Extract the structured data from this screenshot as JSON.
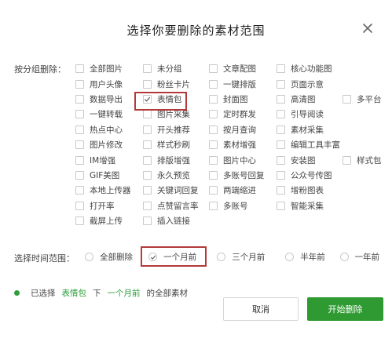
{
  "dialog": {
    "title": "选择你要删除的素材范围"
  },
  "group": {
    "label": "按分组删除：",
    "rows": [
      [
        "全部图片",
        "未分组",
        "文章配图",
        "核心功能图"
      ],
      [
        "用户头像",
        "粉丝卡片",
        "一键排版",
        "页面示意"
      ],
      [
        "数据导出",
        "表情包",
        "封面图",
        "高清图",
        "多平台"
      ],
      [
        "一键转载",
        "图片采集",
        "定时群发",
        "引导阅读"
      ],
      [
        "热点中心",
        "开头推荐",
        "按月查询",
        "素材采集"
      ],
      [
        "图片修改",
        "样式秒刷",
        "素材增强",
        "编辑工具丰富"
      ],
      [
        "IM增强",
        "排版增强",
        "图片中心",
        "安装图",
        "样式包"
      ],
      [
        "GIF美图",
        "永久预览",
        "多账号回复",
        "公众号传图"
      ],
      [
        "本地上传器",
        "关键词回复",
        "两端缩进",
        "增粉图表"
      ],
      [
        "打开率",
        "点赞留言率",
        "多账号",
        "智能采集"
      ],
      [
        "截屏上传",
        "插入链接"
      ]
    ],
    "checked": "表情包"
  },
  "time": {
    "label": "选择时间范围：",
    "options": [
      "全部删除",
      "一个月前",
      "三个月前",
      "半年前",
      "一年前"
    ],
    "selected": "一个月前"
  },
  "summary": {
    "prefix": "已选择",
    "group": "表情包",
    "mid": "下",
    "time": "一个月前",
    "suffix": "的全部素材"
  },
  "buttons": {
    "cancel": "取消",
    "start": "开始删除"
  },
  "colors": {
    "accent_green": "#2f9a32",
    "highlight_red": "#b23a3a"
  }
}
